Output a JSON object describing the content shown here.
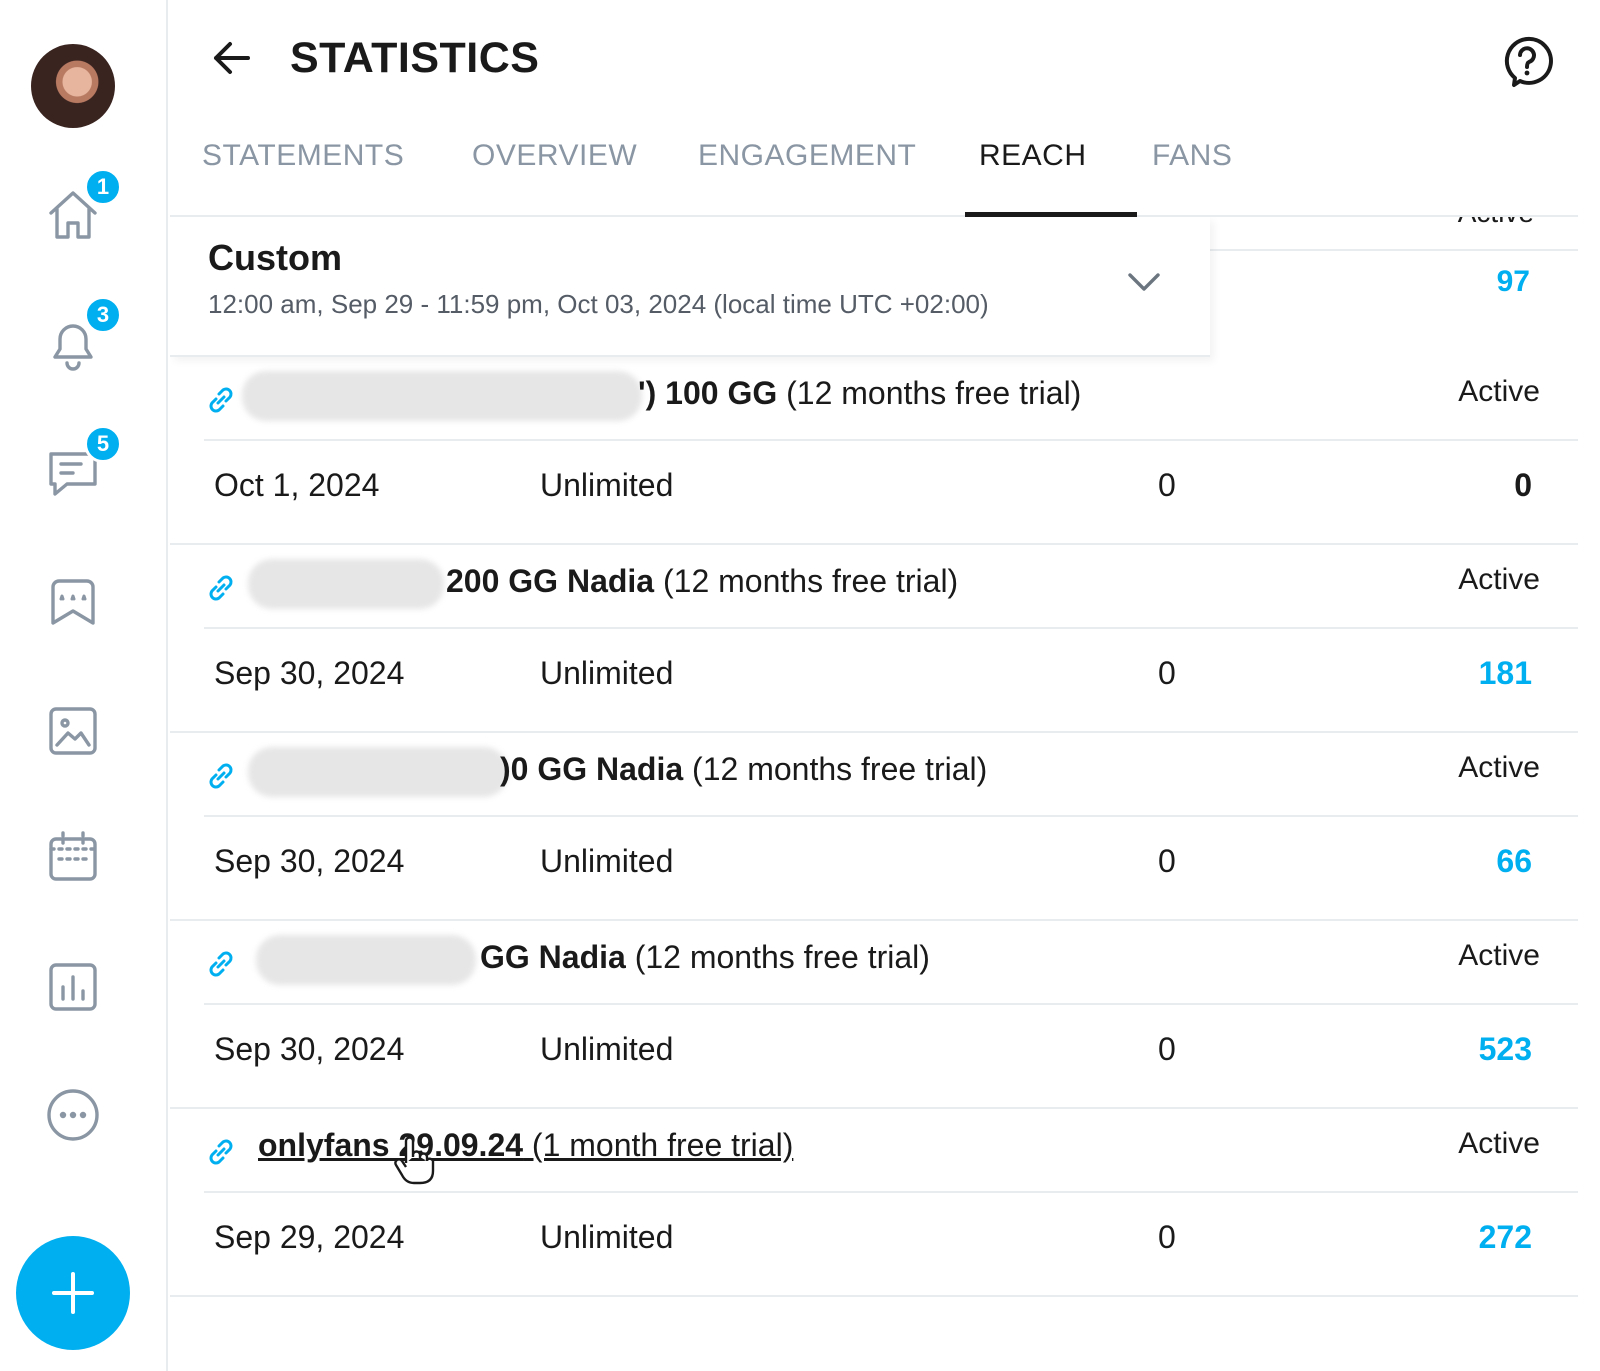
{
  "sidebar": {
    "badges": {
      "home": "1",
      "notifications": "3",
      "messages": "5"
    }
  },
  "header": {
    "title": "STATISTICS"
  },
  "tabs": [
    {
      "label": "STATEMENTS"
    },
    {
      "label": "OVERVIEW"
    },
    {
      "label": "ENGAGEMENT"
    },
    {
      "label": "REACH",
      "active": true
    },
    {
      "label": "FANS"
    }
  ],
  "ghost_row": {
    "status": "Active",
    "value": "97"
  },
  "period": {
    "label": "Custom",
    "range": "12:00 am, Sep 29 - 11:59 pm, Oct 03, 2024 (local time UTC +02:00)"
  },
  "campaigns": [
    {
      "name_bold": "') 100 GG",
      "name_rest": " (12 months free trial)",
      "status": "Active",
      "date": "Oct 1, 2024",
      "limit": "Unlimited",
      "col3": "0",
      "count": "0"
    },
    {
      "name_bold": "200 GG Nadia",
      "name_rest": " (12 months free trial)",
      "status": "Active",
      "date": "Sep 30, 2024",
      "limit": "Unlimited",
      "col3": "0",
      "count": "181"
    },
    {
      "name_bold": ")0 GG Nadia",
      "name_rest": " (12 months free trial)",
      "status": "Active",
      "date": "Sep 30, 2024",
      "limit": "Unlimited",
      "col3": "0",
      "count": "66"
    },
    {
      "name_bold": "GG Nadia",
      "name_rest": " (12 months free trial)",
      "status": "Active",
      "date": "Sep 30, 2024",
      "limit": "Unlimited",
      "col3": "0",
      "count": "523"
    },
    {
      "name_bold": "onlyfans 29.09.24",
      "name_rest": " (1 month free trial)",
      "status": "Active",
      "date": "Sep 29, 2024",
      "limit": "Unlimited",
      "col3": "0",
      "count": "272"
    }
  ],
  "colors": {
    "accent": "#00aff0",
    "muted": "#8a96a3",
    "divider": "#e9ecef"
  }
}
